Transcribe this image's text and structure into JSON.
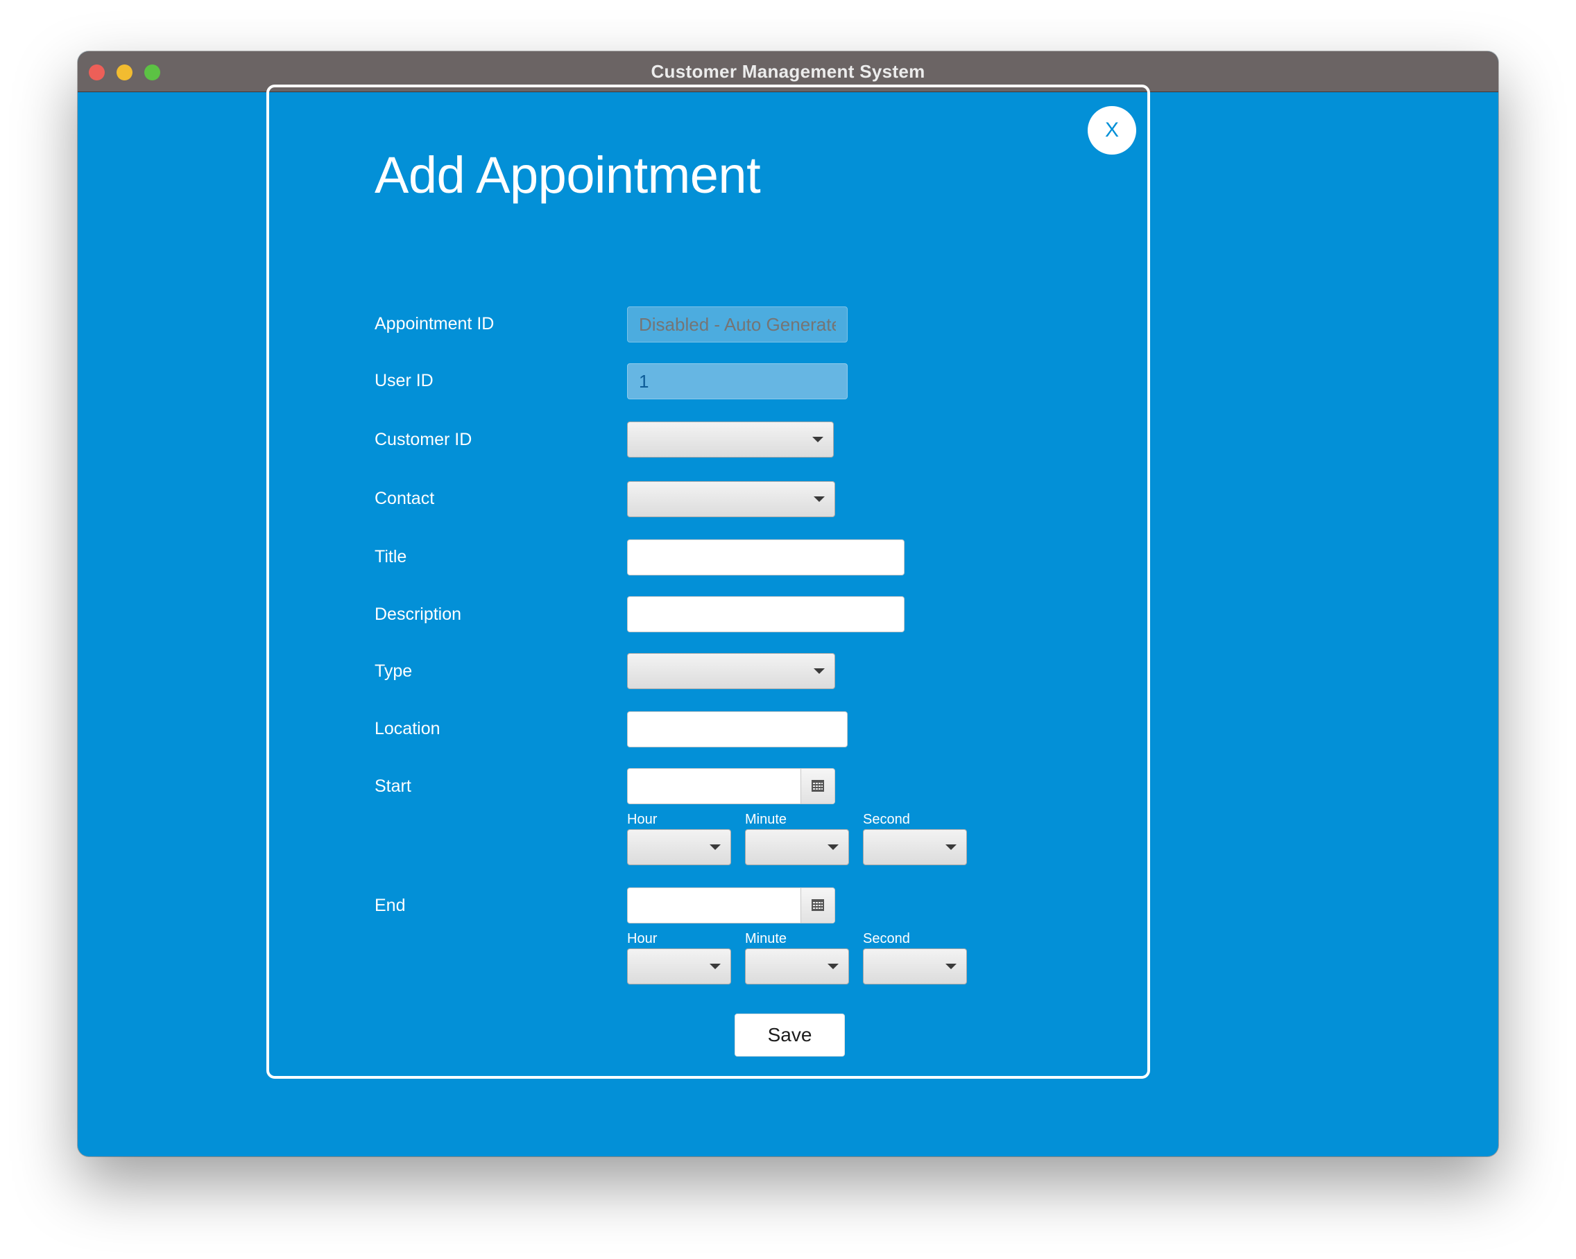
{
  "window": {
    "title": "Customer Management System"
  },
  "dialog": {
    "close_label": "X",
    "heading": "Add Appointment",
    "fields": {
      "appointment_id": {
        "label": "Appointment ID",
        "placeholder": "Disabled - Auto Generated",
        "value": ""
      },
      "user_id": {
        "label": "User ID",
        "value": "1"
      },
      "customer_id": {
        "label": "Customer ID",
        "selected": ""
      },
      "contact": {
        "label": "Contact",
        "selected": ""
      },
      "title": {
        "label": "Title",
        "value": ""
      },
      "description": {
        "label": "Description",
        "value": ""
      },
      "type": {
        "label": "Type",
        "selected": ""
      },
      "location": {
        "label": "Location",
        "value": ""
      },
      "start": {
        "label": "Start",
        "date": "",
        "hour_label": "Hour",
        "minute_label": "Minute",
        "second_label": "Second"
      },
      "end": {
        "label": "End",
        "date": "",
        "hour_label": "Hour",
        "minute_label": "Minute",
        "second_label": "Second"
      }
    },
    "save_label": "Save"
  },
  "icons": {
    "dropdown": "chevron-down-icon",
    "date_picker": "calendar-icon"
  },
  "colors": {
    "background": "#0390d7",
    "titlebar": "#6b6464",
    "traffic_close": "#ed5f58",
    "traffic_minimize": "#f2bc30",
    "traffic_maximize": "#5cc244"
  }
}
